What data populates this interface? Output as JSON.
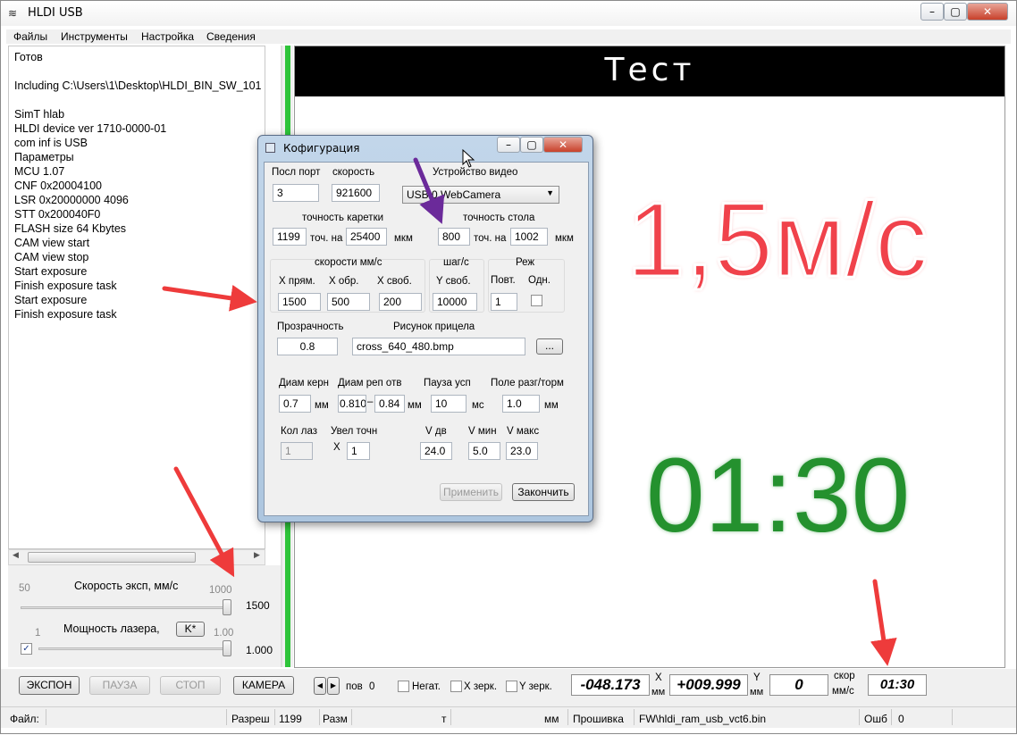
{
  "window": {
    "title": "HLDI USB"
  },
  "menu": [
    "Файлы",
    "Инструменты",
    "Настройка",
    "Сведения"
  ],
  "log": {
    "lines": [
      "Готов",
      "",
      "Including C:\\Users\\1\\Desktop\\HLDI_BIN_SW_101",
      "",
      "SimT hlab",
      "HLDI device ver 1710-0000-01",
      "com inf is USB",
      "Параметры",
      "MCU 1.07",
      "CNF 0x20004100",
      "LSR 0x20000000 4096",
      "STT 0x200040F0",
      "FLASH size 64 Kbytes",
      "CAM view start",
      "CAM view stop",
      "Start exposure",
      "Finish exposure task",
      "Start exposure",
      "Finish exposure task"
    ]
  },
  "controls": {
    "speed_label": "Скорость эксп, мм/с",
    "speed_min": "50",
    "speed_max": "1000",
    "speed_value": "1500",
    "laser_label": "Мощность лазера,",
    "laser_button": "K*",
    "laser_min": "1",
    "laser_max": "1.00",
    "laser_value": "1.000",
    "speed_slider_level": 1.0,
    "laser_slider_level": 1.0
  },
  "buttons": {
    "expose": "ЭКСПОН",
    "pause": "ПАУЗА",
    "stop": "СТОП",
    "camera": "КАМЕРА"
  },
  "viewer": {
    "header": "Тест",
    "speed_overlay": "1,5м/с",
    "time_overlay": "01:30"
  },
  "bottom": {
    "pos_label": "пов",
    "pos_value": "0",
    "neg_label": "Негат.",
    "xmirror_label": "X зерк.",
    "ymirror_label": "Y зерк.",
    "x_value": "-048.173",
    "x_label": "X",
    "x_unit": "мм",
    "y_value": "+009.999",
    "y_label": "Y",
    "y_unit": "мм",
    "speed_value": "0",
    "speed_label": "скор",
    "speed_unit": "мм/с",
    "time_value": "01:30"
  },
  "status": {
    "file_label": "Файл:",
    "res_label": "Разреш",
    "res_value": "1199",
    "size_label": "Разм",
    "t_label": "т",
    "mm_label": "мм",
    "fw_label": "Прошивка",
    "fw_value": "FW\\hldi_ram_usb_vct6.bin",
    "err_label": "Ошб",
    "err_value": "0"
  },
  "dialog": {
    "title": "Кофигурация",
    "port_label": "Посл порт",
    "port_value": "3",
    "baud_label": "скорость",
    "baud_value": "921600",
    "video_label": "Устройство видео",
    "video_value": "USB 0 WebCamera",
    "carriage_label": "точность каретки",
    "carriage_value": "1199",
    "carriage_on": "точ. на",
    "carriage_mkm_value": "25400",
    "carriage_unit": "мкм",
    "table_label": "точность стола",
    "table_value": "800",
    "table_on": "точ. на",
    "table_mkm_value": "1002",
    "table_unit": "мкм",
    "speeds_label": "скорости мм/с",
    "x_direct_label": "X прям.",
    "x_direct_value": "1500",
    "x_back_label": "X обр.",
    "x_back_value": "500",
    "x_free_label": "X своб.",
    "x_free_value": "200",
    "step_label": "шаг/с",
    "y_free_label": "Y своб.",
    "y_free_value": "10000",
    "mode_label": "Реж",
    "repeat_label": "Повт.",
    "repeat_value": "1",
    "single_label": "Одн.",
    "opacity_label": "Прозрачность",
    "opacity_value": "0.8",
    "reticle_label": "Рисунок прицела",
    "reticle_value": "cross_640_480.bmp",
    "browse_label": "...",
    "core_label": "Диам керн",
    "core_value": "0.7",
    "core_unit": "мм",
    "rep_label": "Диам реп отв",
    "rep_from": "0.810",
    "rep_dash": "–",
    "rep_to": "0.84",
    "rep_unit": "мм",
    "pause_label": "Пауза усп",
    "pause_value": "10",
    "pause_unit": "мс",
    "field_label": "Поле разг/торм",
    "field_value": "1.0",
    "field_unit": "мм",
    "lasers_label": "Кол лаз",
    "lasers_value": "1",
    "zoom_label": "Увел точн",
    "zoom_x": "X",
    "zoom_value": "1",
    "vdv_label": "V дв",
    "vdv_value": "24.0",
    "vmin_label": "V мин",
    "vmin_value": "5.0",
    "vmax_label": "V макс",
    "vmax_value": "23.0",
    "apply_label": "Применить",
    "finish_label": "Закончить"
  },
  "colors": {
    "accent_red": "#f0424b",
    "accent_green": "#24912e",
    "arrow_red": "#ee3b3b",
    "arrow_purple": "#6b2a9a",
    "progress_green": "#2ec43a"
  }
}
